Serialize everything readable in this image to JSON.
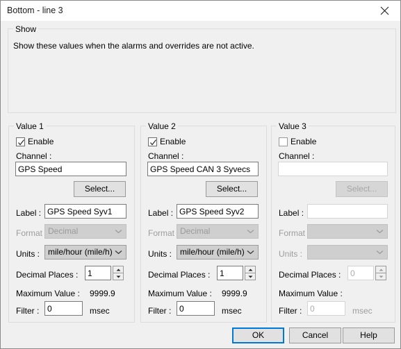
{
  "window": {
    "title": "Bottom - line 3",
    "close_icon": "close-icon"
  },
  "show_group": {
    "legend": "Show",
    "description": "Show these values when the alarms and overrides are not active."
  },
  "labels": {
    "enable": "Enable",
    "channel": "Channel :",
    "select": "Select...",
    "label": "Label :",
    "format": "Format :",
    "units": "Units :",
    "decimal_places": "Decimal Places :",
    "maximum_value": "Maximum Value :",
    "filter": "Filter :",
    "msec": "msec"
  },
  "values": [
    {
      "legend": "Value 1",
      "enabled": true,
      "channel_value": "GPS Speed",
      "channel_placeholder": "",
      "select_enabled": false,
      "label_value": "GPS Speed Syv1",
      "format_value": "Decimal",
      "format_enabled": false,
      "units_value": "mile/hour (mile/h)",
      "units_enabled": true,
      "decimal_places_value": "1",
      "maximum_value": "9999.9",
      "filter_value": "0",
      "msec": "msec"
    },
    {
      "legend": "Value 2",
      "enabled": true,
      "channel_value": "GPS Speed CAN 3 Syvecs",
      "channel_placeholder": "",
      "select_enabled": false,
      "label_value": "GPS Speed Syv2",
      "format_value": "Decimal",
      "format_enabled": false,
      "units_value": "mile/hour (mile/h)",
      "units_enabled": true,
      "decimal_places_value": "1",
      "maximum_value": "9999.9",
      "filter_value": "0",
      "msec": "msec"
    },
    {
      "legend": "Value 3",
      "enabled": false,
      "channel_value": "",
      "channel_placeholder": "",
      "select_enabled": false,
      "label_value": "",
      "format_value": "",
      "format_enabled": false,
      "units_value": "",
      "units_enabled": false,
      "decimal_places_value": "0",
      "maximum_value": "",
      "filter_value": "0",
      "msec": "msec"
    }
  ],
  "footer": {
    "ok": "OK",
    "cancel": "Cancel",
    "help": "Help"
  },
  "colors": {
    "accent": "#0078d7",
    "dialog_bg": "#f0f0f0",
    "titlebar_bg": "#ffffff",
    "disabled_text": "#9d9d9d"
  }
}
